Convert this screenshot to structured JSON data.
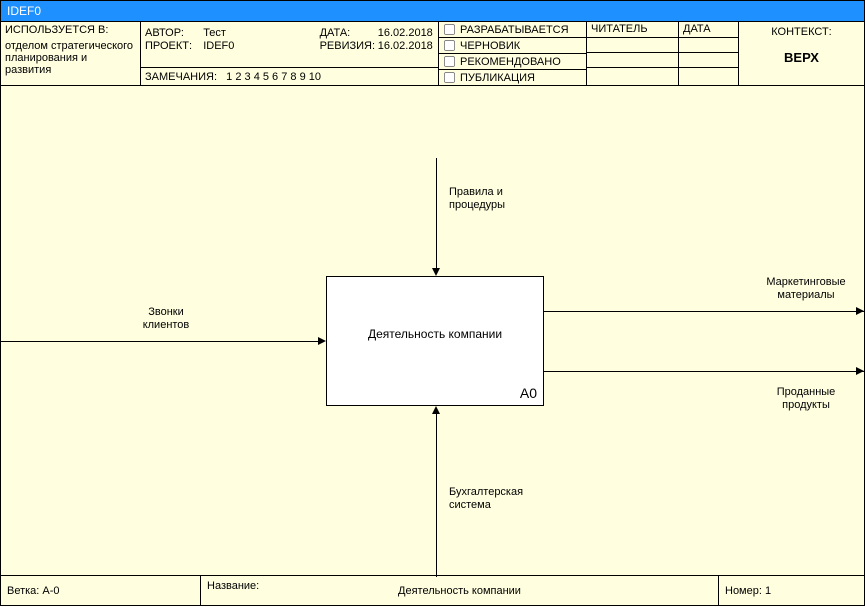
{
  "title": "IDEF0",
  "header": {
    "used_in_label": "ИСПОЛЬЗУЕТСЯ В:",
    "used_in_value": "отделом стратегического планирования и развития",
    "author_label": "АВТОР:",
    "author_value": "Тест",
    "project_label": "ПРОЕКТ:",
    "project_value": "IDEF0",
    "date_label": "ДАТА:",
    "date_value": "16.02.2018",
    "revision_label": "РЕВИЗИЯ:",
    "revision_value": "16.02.2018",
    "remarks_label": "ЗАМЕЧАНИЯ:",
    "remarks_nums": "1  2  3  4  5  6  7  8  9  10",
    "status": [
      "РАЗРАБАТЫВАЕТСЯ",
      "ЧЕРНОВИК",
      "РЕКОМЕНДОВАНО",
      "ПУБЛИКАЦИЯ"
    ],
    "reader_label": "ЧИТАТЕЛЬ",
    "sdate_label": "ДАТА",
    "context_label": "КОНТЕКСТ:",
    "context_value": "ВЕРХ"
  },
  "activity": {
    "title": "Деятельность компании",
    "id": "A0"
  },
  "arrows": {
    "input": "Звонки\nклиентов",
    "control": "Правила и\nпроцедуры",
    "mechanism": "Бухгалтерская\nсистема",
    "output1": "Маркетинговые\nматериалы",
    "output2": "Проданные\nпродукты"
  },
  "footer": {
    "branch_label": "Ветка:",
    "branch_value": "A-0",
    "name_label": "Название:",
    "name_value": "Деятельность компании",
    "number_label": "Номер:",
    "number_value": "1"
  }
}
